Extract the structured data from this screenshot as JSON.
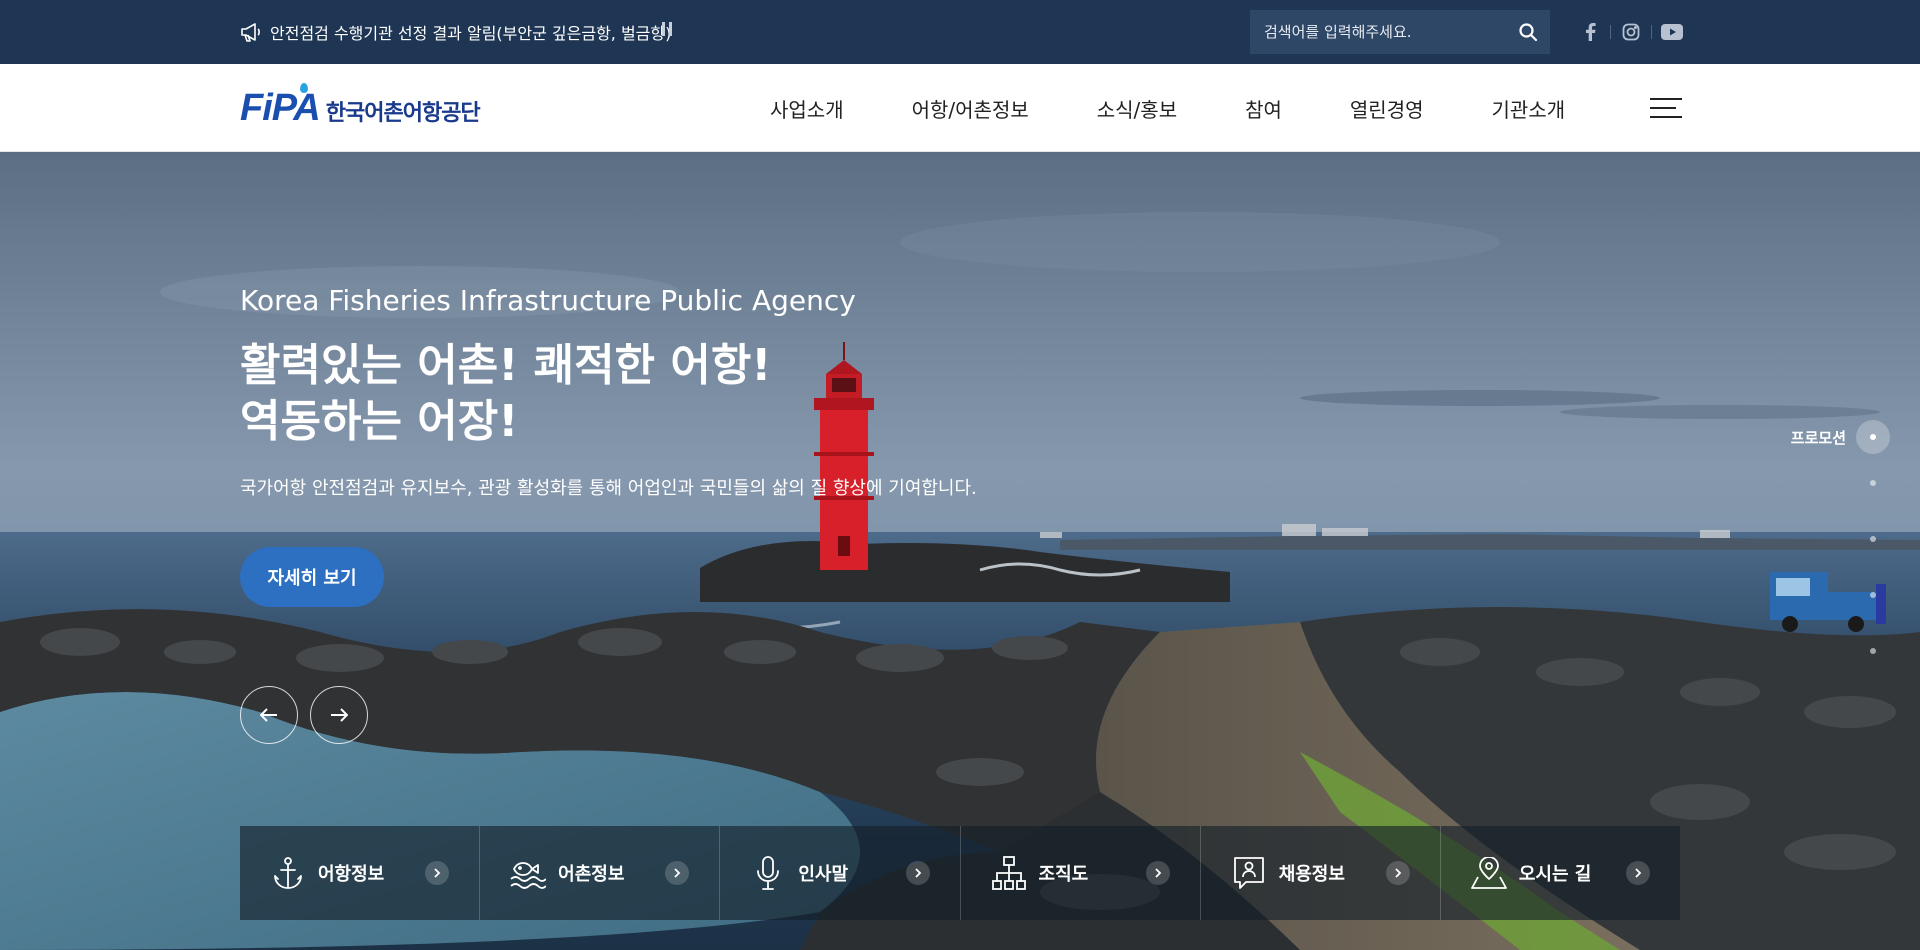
{
  "topbar": {
    "notice_text": "안전점검 수행기관 선정 결과 알림(부안군 깊은금항, 벌금항)",
    "notice_icon": "megaphone-icon",
    "pause_icon": "pause-icon",
    "search_placeholder": "검색어를 입력해주세요.",
    "search_icon": "search-icon",
    "social": [
      "facebook-icon",
      "instagram-icon",
      "youtube-icon"
    ]
  },
  "header": {
    "logo_mark": "FiPA",
    "logo_text": "한국어촌어항공단",
    "nav": [
      "사업소개",
      "어항/어촌정보",
      "소식/홍보",
      "참여",
      "열린경영",
      "기관소개"
    ],
    "menu_icon": "hamburger-icon"
  },
  "hero": {
    "agency": "Korea Fisheries Infrastructure Public Agency",
    "slogan_line1": "활력있는 어촌! 쾌적한 어항!",
    "slogan_line2": "역동하는 어장!",
    "description": "국가어항 안전점검과 유지보수, 관광 활성화를 통해 어업인과 국민들의 삶의 질 향상에 기여합니다.",
    "more_button": "자세히 보기",
    "prev_icon": "arrow-left-icon",
    "next_icon": "arrow-right-icon",
    "pager_label": "프로모션",
    "slide_count": 5,
    "active_slide": 1
  },
  "quick_links": [
    {
      "label": "어항정보",
      "icon": "anchor-icon"
    },
    {
      "label": "어촌정보",
      "icon": "fishing-village-icon"
    },
    {
      "label": "인사말",
      "icon": "microphone-icon"
    },
    {
      "label": "조직도",
      "icon": "org-chart-icon"
    },
    {
      "label": "채용정보",
      "icon": "recruit-icon"
    },
    {
      "label": "오시는 길",
      "icon": "location-pin-icon"
    }
  ],
  "colors": {
    "topbar_bg": "#1e3654",
    "search_bg": "#2f4767",
    "brand_blue": "#1a4fb0",
    "button_blue": "#2d6fc1",
    "lighthouse_red": "#d8202a"
  }
}
